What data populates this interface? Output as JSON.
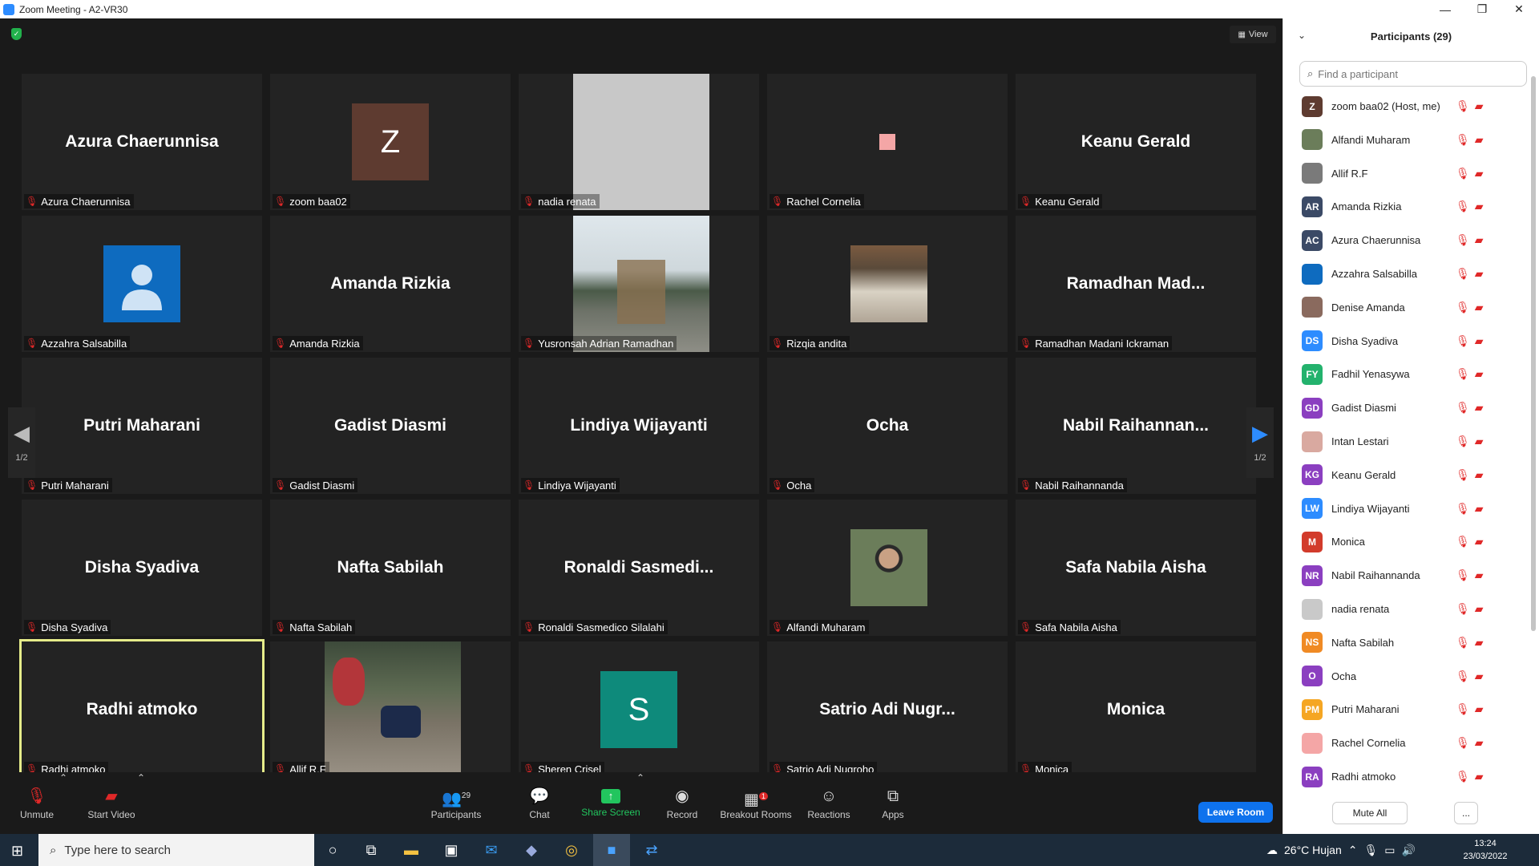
{
  "window": {
    "title": "Zoom Meeting - A2-VR30",
    "min": "—",
    "max": "❐",
    "close": "✕"
  },
  "view_btn": {
    "label": "View"
  },
  "tiles": [
    {
      "big": "Azura Chaerunnisa",
      "label": "Azura Chaerunnisa"
    },
    {
      "big": "",
      "label": "zoom baa02",
      "avatar": "Z",
      "avatar_color": "#5e3b30"
    },
    {
      "big": "",
      "label": "nadia renata",
      "photo": "gray"
    },
    {
      "big": "",
      "label": "Rachel Cornelia",
      "square_color": "#f4a6a6"
    },
    {
      "big": "Keanu Gerald",
      "label": "Keanu Gerald"
    },
    {
      "big": "",
      "label": "Azzahra Salsabilla",
      "avatar": "person",
      "avatar_color": "#0e6bbf"
    },
    {
      "big": "Amanda Rizkia",
      "label": "Amanda Rizkia"
    },
    {
      "big": "",
      "label": "Yusronsah Adrian Ramadhan",
      "photo": "outdoor"
    },
    {
      "big": "",
      "label": "Rizqia andita",
      "photo": "shop"
    },
    {
      "big": "Ramadhan  Mad...",
      "label": "Ramadhan Madani Ickraman"
    },
    {
      "big": "Putri Maharani",
      "label": "Putri Maharani"
    },
    {
      "big": "Gadist Diasmi",
      "label": "Gadist Diasmi"
    },
    {
      "big": "Lindiya Wijayanti",
      "label": "Lindiya Wijayanti"
    },
    {
      "big": "Ocha",
      "label": "Ocha"
    },
    {
      "big": "Nabil  Raihannan...",
      "label": "Nabil Raihannanda"
    },
    {
      "big": "Disha Syadiva",
      "label": "Disha Syadiva"
    },
    {
      "big": "Nafta Sabilah",
      "label": "Nafta Sabilah"
    },
    {
      "big": "Ronaldi  Sasmedi...",
      "label": "Ronaldi Sasmedico Silalahi"
    },
    {
      "big": "",
      "label": "Alfandi Muharam",
      "photo": "portrait"
    },
    {
      "big": "Safa Nabila Aisha",
      "label": "Safa Nabila Aisha"
    },
    {
      "big": "Radhi atmoko",
      "label": "Radhi atmoko",
      "active": true
    },
    {
      "big": "",
      "label": "Allif R.F",
      "photo": "garden"
    },
    {
      "big": "",
      "label": "Sheren Crisel",
      "avatar": "S",
      "avatar_color": "#0e8a7b"
    },
    {
      "big": "Satrio Adi Nugr...",
      "label": "Satrio Adi Nugroho"
    },
    {
      "big": "Monica",
      "label": "Monica"
    }
  ],
  "pager": {
    "left": "1/2",
    "right": "1/2"
  },
  "toolbar": {
    "unmute": "Unmute",
    "start_video": "Start Video",
    "participants": "Participants",
    "participants_count": "29",
    "chat": "Chat",
    "share_screen": "Share Screen",
    "record": "Record",
    "breakout_rooms": "Breakout Rooms",
    "breakout_badge": "1",
    "reactions": "Reactions",
    "apps": "Apps",
    "leave_room": "Leave Room"
  },
  "panel": {
    "title": "Participants (29)",
    "search_placeholder": "Find a participant",
    "mute_all": "Mute All",
    "more": "...",
    "participants": [
      {
        "initials": "Z",
        "color": "#5e3b30",
        "name": "zoom baa02 (Host, me)"
      },
      {
        "initials": "",
        "color": "#6b7d5a",
        "name": "Alfandi Muharam"
      },
      {
        "initials": "",
        "color": "#7a7a7a",
        "name": "Allif R.F"
      },
      {
        "initials": "AR",
        "color": "#3b4a66",
        "name": "Amanda Rizkia"
      },
      {
        "initials": "AC",
        "color": "#3b4a66",
        "name": "Azura Chaerunnisa"
      },
      {
        "initials": "",
        "color": "#0e6bbf",
        "name": "Azzahra Salsabilla"
      },
      {
        "initials": "",
        "color": "#8a6a5e",
        "name": "Denise Amanda"
      },
      {
        "initials": "DS",
        "color": "#2d8cff",
        "name": "Disha Syadiva"
      },
      {
        "initials": "FY",
        "color": "#23b26d",
        "name": "Fadhil Yenasywa"
      },
      {
        "initials": "GD",
        "color": "#8b3fc0",
        "name": "Gadist Diasmi"
      },
      {
        "initials": "",
        "color": "#d9a9a0",
        "name": "Intan Lestari"
      },
      {
        "initials": "KG",
        "color": "#8b3fc0",
        "name": "Keanu Gerald"
      },
      {
        "initials": "LW",
        "color": "#2d8cff",
        "name": "Lindiya Wijayanti"
      },
      {
        "initials": "M",
        "color": "#d23b2b",
        "name": "Monica"
      },
      {
        "initials": "NR",
        "color": "#8b3fc0",
        "name": "Nabil Raihannanda"
      },
      {
        "initials": "",
        "color": "#c9c9c9",
        "name": "nadia renata"
      },
      {
        "initials": "NS",
        "color": "#f08a24",
        "name": "Nafta Sabilah"
      },
      {
        "initials": "O",
        "color": "#8b3fc0",
        "name": "Ocha"
      },
      {
        "initials": "PM",
        "color": "#f5a623",
        "name": "Putri Maharani"
      },
      {
        "initials": "",
        "color": "#f4a6a6",
        "name": "Rachel Cornelia"
      },
      {
        "initials": "RA",
        "color": "#8b3fc0",
        "name": "Radhi atmoko"
      }
    ]
  },
  "taskbar": {
    "search_placeholder": "Type here to search",
    "weather": "26°C  Hujan",
    "time": "13:24",
    "date": "23/03/2022"
  }
}
